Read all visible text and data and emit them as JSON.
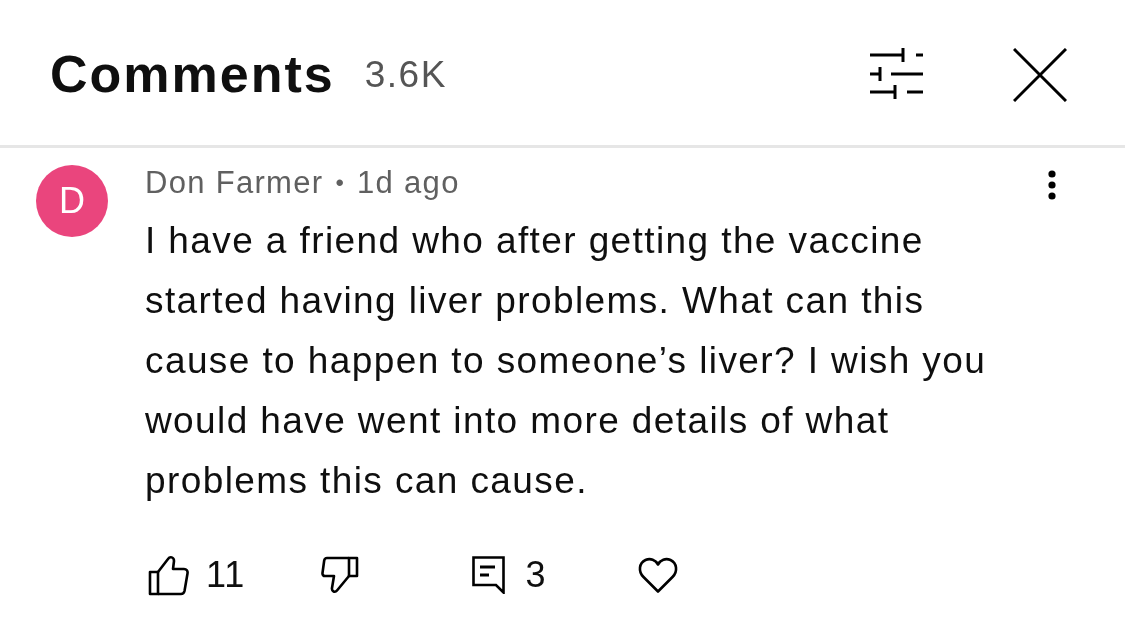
{
  "header": {
    "title": "Comments",
    "count": "3.6K"
  },
  "comments": [
    {
      "avatar_letter": "D",
      "color": "#ea457d",
      "author": "Don Farmer",
      "separator": "•",
      "time": "1d ago",
      "text": "I have a friend who after getting the vaccine started having liver problems. What can this cause to happen to someone’s liver? I wish you would have went into more details of what problems this can cause.",
      "likes": "11",
      "replies": "3"
    }
  ]
}
